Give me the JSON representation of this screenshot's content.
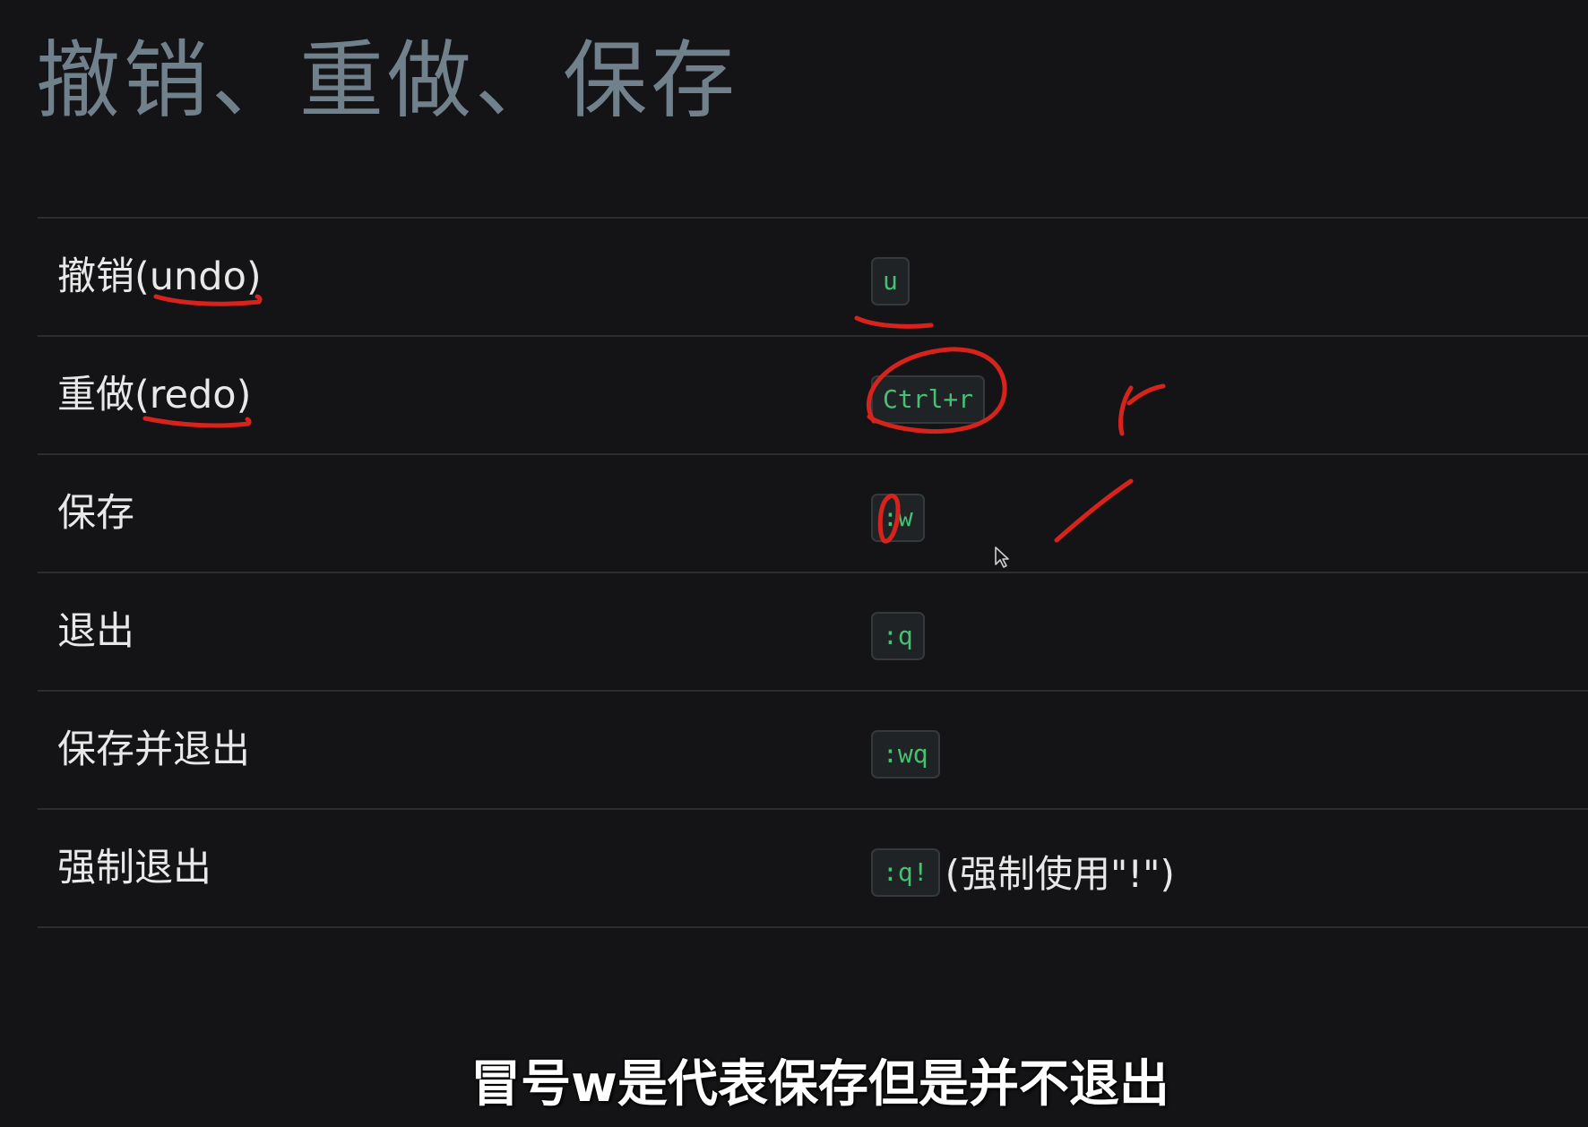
{
  "page": {
    "title": "撤销、重做、保存",
    "caption": "冒号w是代表保存但是并不退出"
  },
  "rows": [
    {
      "label": "撤销(undo)",
      "key": "u",
      "note": ""
    },
    {
      "label": "重做(redo)",
      "key": "Ctrl+r",
      "note": ""
    },
    {
      "label": "保存",
      "key": ":w",
      "note": ""
    },
    {
      "label": "退出",
      "key": ":q",
      "note": ""
    },
    {
      "label": "保存并退出",
      "key": ":wq",
      "note": ""
    },
    {
      "label": "强制退出",
      "key": ":q!",
      "note": "(强制使用\"!\")"
    }
  ],
  "colors": {
    "background": "#141416",
    "title": "#71818c",
    "key_text": "#46c173",
    "annotation_ink": "#d8231d"
  },
  "icons": {
    "mouse_cursor": "arrow-pointer-icon"
  }
}
